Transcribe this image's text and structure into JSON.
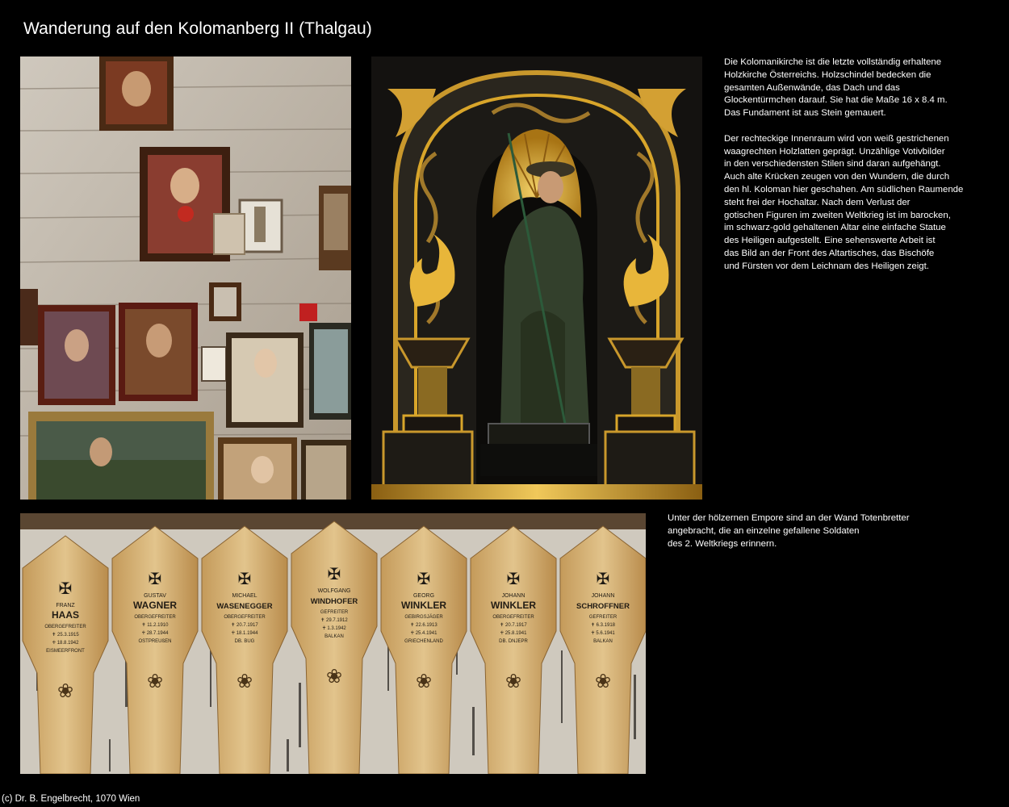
{
  "page": {
    "title": "Wanderung auf den Kolomanberg II (Thalgau)",
    "footer": "(c) Dr. B. Engelbrecht, 1070 Wien"
  },
  "text": {
    "block1": [
      "Die Kolomanikirche ist die letzte vollständig erhaltene\nHolzkirche Österreichs. Holzschindel bedecken die\ngesamten Außenwände, das Dach und das\nGlockentürmchen darauf. Sie hat die Maße 16 x 8.4 m.\nDas Fundament ist aus Stein gemauert.",
      "Der rechteckige Innenraum wird von weiß gestrichenen\nwaagrechten Holzlatten geprägt. Unzählige Votivbilder\nin den verschiedensten Stilen sind daran aufgehängt.\nAuch alte Krücken zeugen von den Wundern, die durch\nden hl. Koloman hier geschahen. Am südlichen Raumende\nsteht frei der Hochaltar. Nach dem Verlust der\ngotischen Figuren im zweiten Weltkrieg ist im barocken,\nim schwarz-gold gehaltenen Altar eine einfache Statue\ndes Heiligen aufgestellt. Eine sehenswerte Arbeit ist\ndas Bild an der Front des Altartisches, das Bischöfe\nund Fürsten vor dem Leichnam des Heiligen zeigt."
    ],
    "block2": "Unter der hölzernen Empore sind an der Wand Totenbretter\nangebracht, die an einzelne gefallene Soldaten\ndes 2. Weltkriegs erinnern."
  },
  "boards": [
    {
      "first": "FRANZ",
      "last": "HAAS",
      "rank": "OBERGEFREITER",
      "born": "✝ 25.3.1915",
      "died": "♰ 18.8.1942",
      "place": "EISMEERFRONT"
    },
    {
      "first": "GUSTAV",
      "last": "WAGNER",
      "rank": "OBERGEFREITER",
      "born": "✝ 11.2.1910",
      "died": "♰ 28.7.1944",
      "place": "OSTPREUßEN"
    },
    {
      "first": "MICHAEL",
      "last": "WASENEGGER",
      "rank": "OBERGEFREITER",
      "born": "✝ 20.7.1917",
      "died": "♰ 18.1.1944",
      "place": "DB. BUG"
    },
    {
      "first": "WOLFGANG",
      "last": "WINDHOFER",
      "rank": "GEFREITER",
      "born": "✝ 29.7.1912",
      "died": "♰ 1.3.1942",
      "place": "BALKAN"
    },
    {
      "first": "GEORG",
      "last": "WINKLER",
      "rank": "GEBIRGSJÄGER",
      "born": "✝ 22.6.1913",
      "died": "♰ 25.4.1941",
      "place": "GRIECHENLAND"
    },
    {
      "first": "JOHANN",
      "last": "WINKLER",
      "rank": "OBERGEFREITER",
      "born": "✝ 20.7.1917",
      "died": "♰ 25.8.1941",
      "place": "DB. DNJEPR"
    },
    {
      "first": "JOHANN",
      "last": "SCHROFFNER",
      "rank": "GEFREITER",
      "born": "✝ 6.3.1918",
      "died": "♰ 5.6.1941",
      "place": "BALKAN"
    }
  ],
  "colors": {
    "background": "#000000",
    "text": "#ffffff",
    "wood_light": "#d9b77c",
    "wood_dark": "#a87a3c",
    "gold": "#d8a52a",
    "altar_black": "#141210"
  }
}
